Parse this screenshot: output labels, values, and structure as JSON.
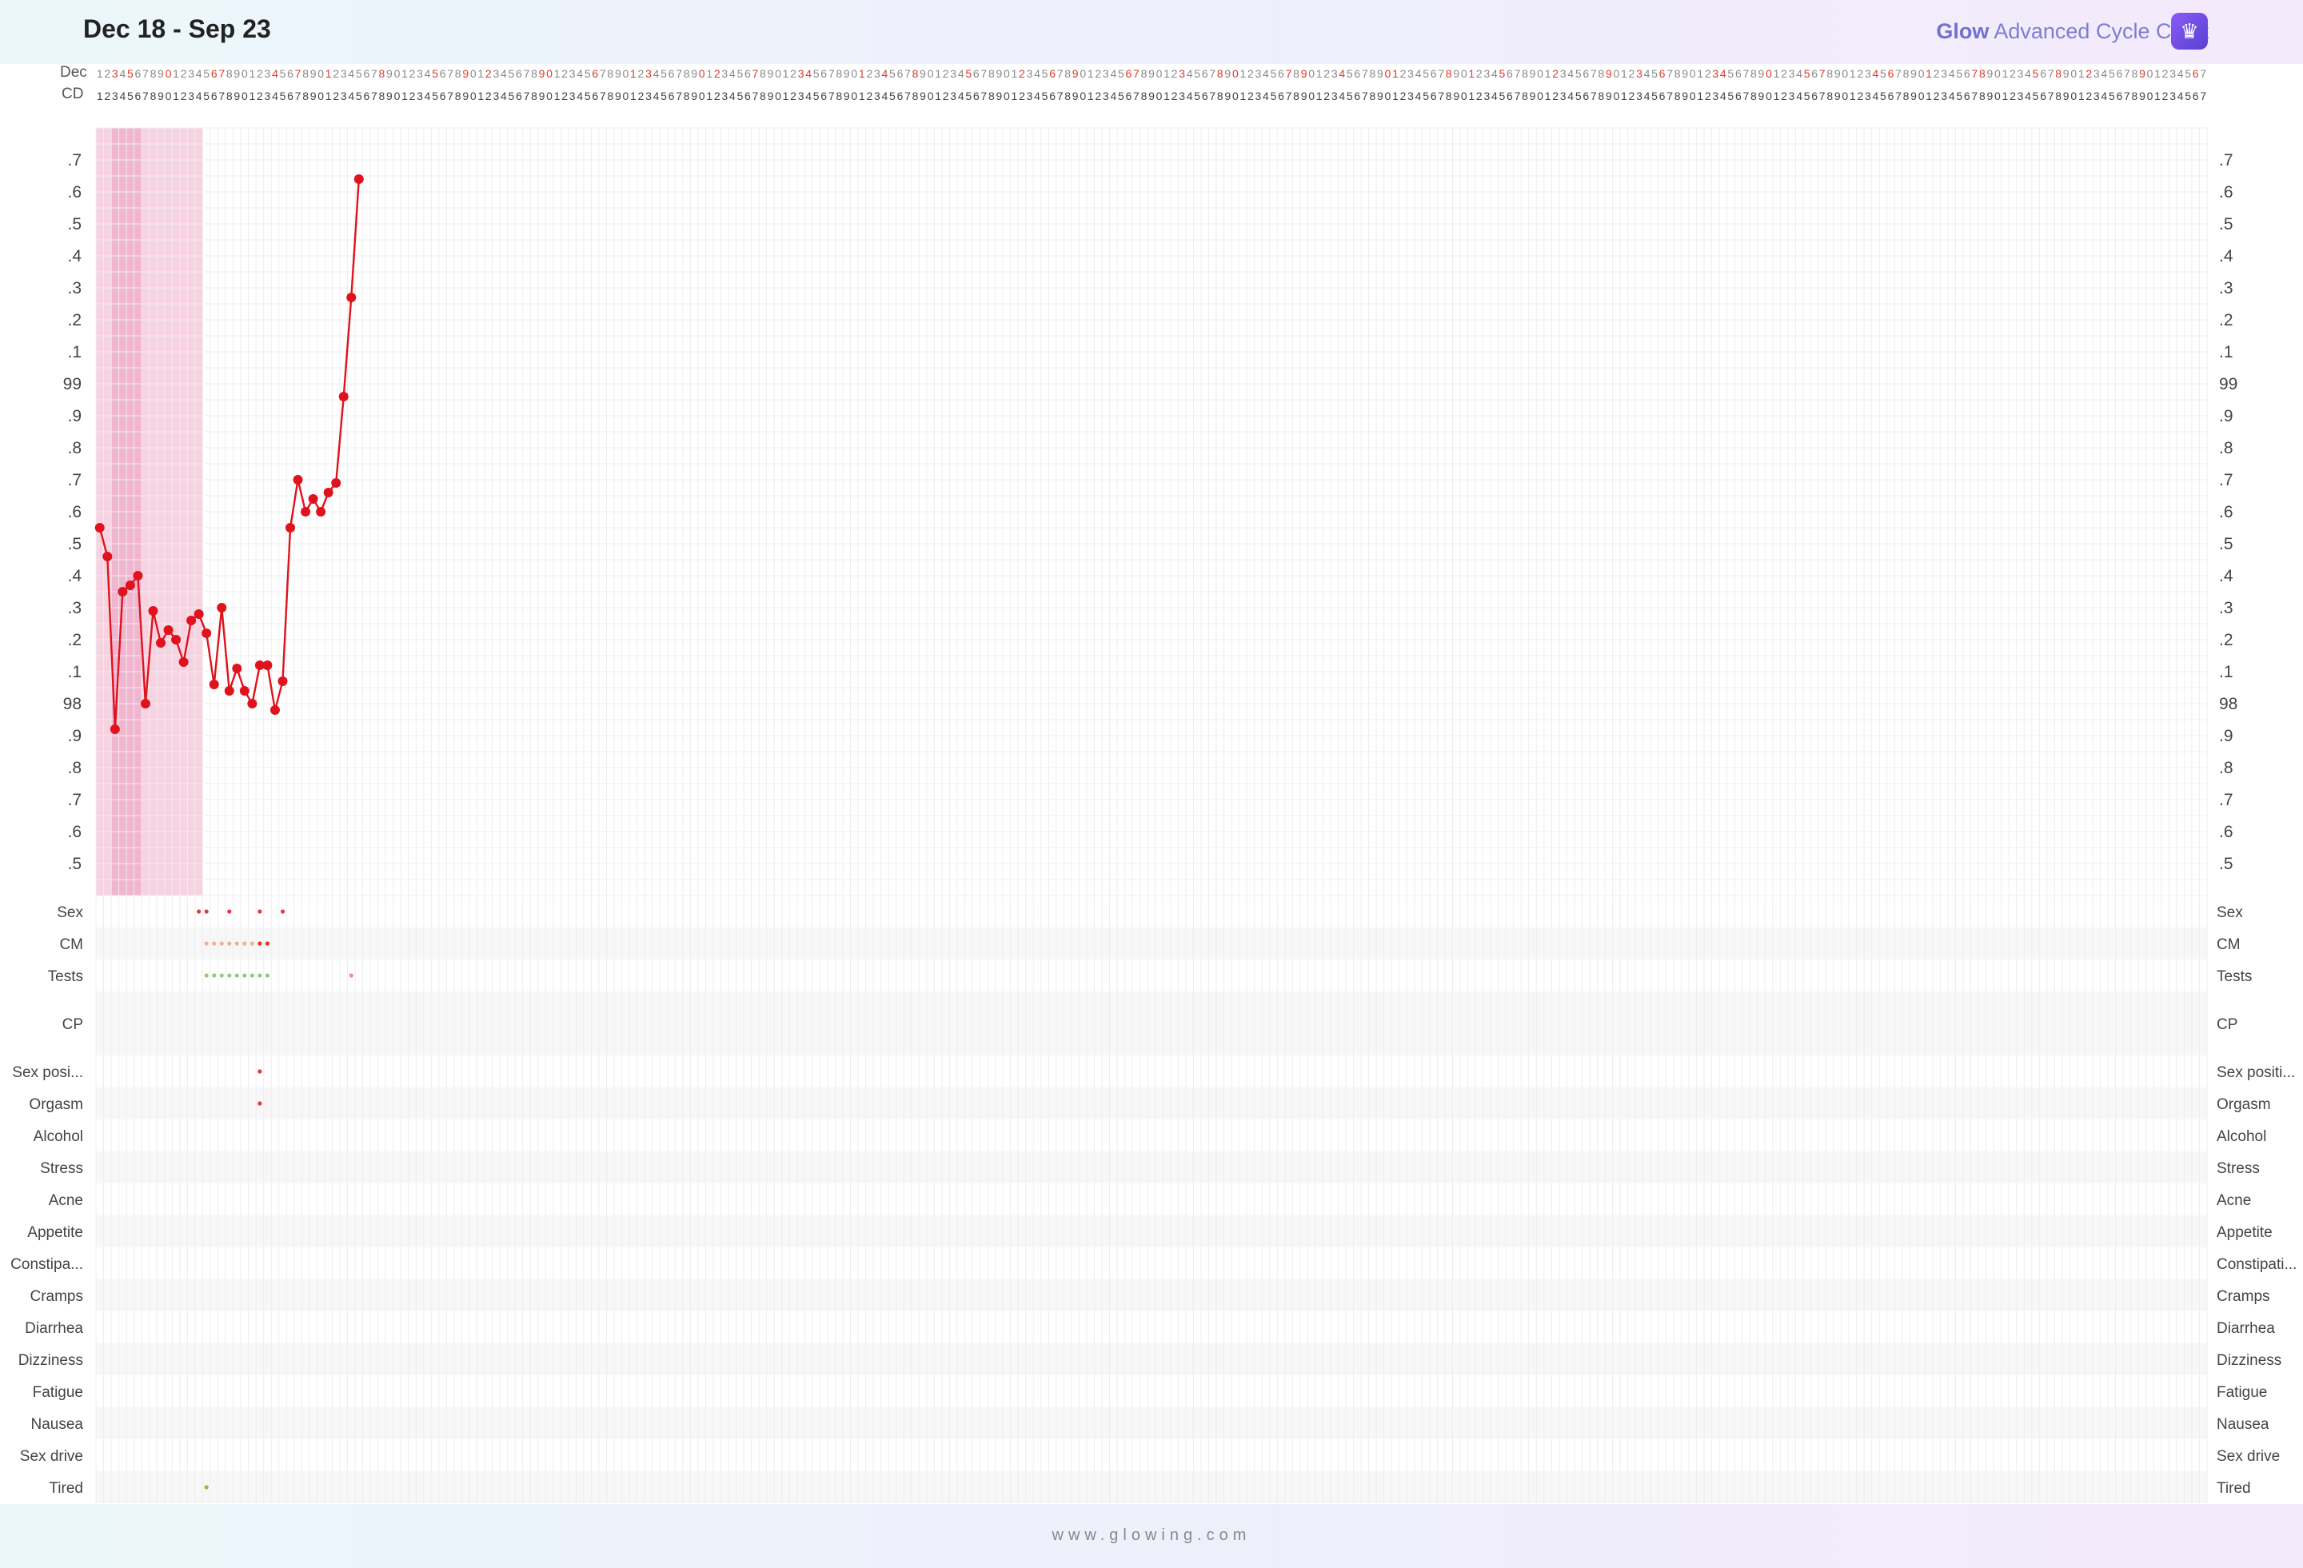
{
  "header": {
    "date_range": "Dec 18 - Sep 23",
    "brand_glow": "Glow",
    "brand_title": "Advanced Cycle Chart",
    "icon": "crown-icon"
  },
  "top_rows": {
    "date_label": "Dec",
    "cd_label": "CD"
  },
  "footer": {
    "url": "www.glowing.com"
  },
  "colors": {
    "line": "#e0121c",
    "period_light": "#f7d3e2",
    "period_dark": "#f2b5cf",
    "grid": "#eeeeee",
    "tick_highlight": "#e0392b"
  },
  "chart_data": {
    "type": "line",
    "title": "",
    "xlabel": "Cycle day",
    "ylabel": "",
    "y_ticks_left": [
      ".5",
      ".6",
      ".7",
      ".8",
      ".9",
      "98",
      ".1",
      ".2",
      ".3",
      ".4",
      ".5",
      ".6",
      ".7",
      ".8",
      ".9",
      "99",
      ".1",
      ".2",
      ".3",
      ".4",
      ".5",
      ".6",
      ".7"
    ],
    "ylim": [
      97.4,
      99.8
    ],
    "days": 277,
    "period_days": [
      1,
      14
    ],
    "period_heavy_days": [
      3,
      6
    ],
    "series": [
      {
        "values": [
          98.55,
          98.46,
          97.92,
          98.35,
          98.37,
          98.4,
          98.0,
          98.29,
          98.19,
          98.23,
          98.2,
          98.13,
          98.26,
          98.28,
          98.22,
          98.06,
          98.3,
          98.04,
          98.11,
          98.04,
          98.0,
          98.12,
          98.12,
          97.98,
          98.07,
          98.55,
          98.7,
          98.6,
          98.64,
          98.6,
          98.66,
          98.69,
          98.96,
          99.27,
          99.64
        ]
      }
    ],
    "tracking_rows": [
      "Sex",
      "CM",
      "Tests",
      "CP",
      "Sex posi...",
      "Orgasm",
      "Alcohol",
      "Stress",
      "Acne",
      "Appetite",
      "Constipa...",
      "Cramps",
      "Diarrhea",
      "Dizziness",
      "Fatigue",
      "Nausea",
      "Sex drive",
      "Tired"
    ],
    "tracking_rows_right": [
      "Sex",
      "CM",
      "Tests",
      "CP",
      "Sex positi...",
      "Orgasm",
      "Alcohol",
      "Stress",
      "Acne",
      "Appetite",
      "Constipati...",
      "Cramps",
      "Diarrhea",
      "Dizziness",
      "Fatigue",
      "Nausea",
      "Sex drive",
      "Tired"
    ],
    "markers": {
      "Sex": [
        14,
        15,
        18,
        22,
        25
      ],
      "CM": [
        15,
        16,
        17,
        18,
        19,
        20,
        21,
        22,
        23
      ],
      "Tests": [
        15,
        16,
        17,
        18,
        19,
        20,
        21,
        22,
        23,
        34
      ],
      "Sex posi...": [
        22
      ],
      "Orgasm": [
        22
      ],
      "Tired": [
        15
      ]
    }
  }
}
